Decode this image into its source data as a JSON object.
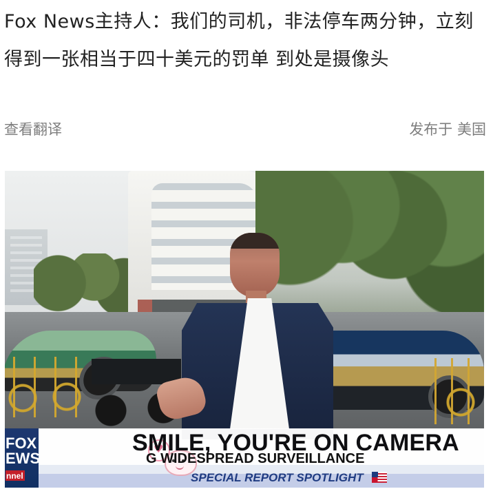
{
  "post": {
    "headline": "Fox News主持人：我们的司机，非法停车两分钟，立刻得到一张相当于四十美元的罚单  到处是摄像头",
    "translate_action": "查看翻译",
    "published_location": "发布于 美国"
  },
  "video": {
    "network_logo": {
      "line1": "FOX",
      "line2": "EWS",
      "line3": "nnel"
    },
    "lower_third": {
      "headline": "SMILE, YOU'RE ON CAMERA",
      "subline": "G WIDESPREAD SURVEILLANCE",
      "spotlight": "SPECIAL REPORT SPOTLIGHT"
    },
    "icons": {
      "flag": "flag-icon",
      "sticker": "sticker-icon"
    }
  },
  "colors": {
    "meta_text": "#7d7d7d",
    "fox_blue": "#1d376f",
    "spotlight_blue": "#203c82"
  }
}
